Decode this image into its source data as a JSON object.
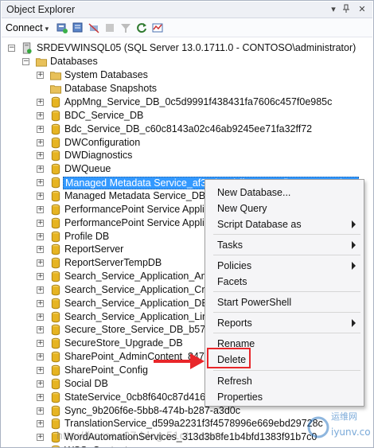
{
  "window": {
    "title": "Object Explorer",
    "pin_icon": "pin-icon",
    "close_icon": "close-icon",
    "dropdown_icon": "dropdown-arrow-icon"
  },
  "toolbar": {
    "connect_label": "Connect",
    "icons": [
      "connect-server-icon",
      "new-query-icon",
      "disconnect-icon",
      "stop-icon",
      "filter-icon",
      "refresh-icon",
      "activity-monitor-icon"
    ]
  },
  "tree": {
    "server": "SRDEVWINSQL05 (SQL Server 13.0.1711.0 - CONTOSO\\administrator)",
    "databases_folder": "Databases",
    "folders": [
      "System Databases",
      "Database Snapshots"
    ],
    "databases": [
      "AppMng_Service_DB_0c5d9991f438431fa7606c457f0e985c",
      "BDC_Service_DB",
      "Bdc_Service_DB_c60c8143a02c46ab9245ee71fa32ff72",
      "DWConfiguration",
      "DWDiagnostics",
      "DWQueue",
      "Managed Metadata Service_af3ad45cbff745a69afbc3ee1040cb9a",
      "Managed Metadata Service_DB",
      "PerformancePoint Service Application_",
      "PerformancePoint Service Application_",
      "Profile DB",
      "ReportServer",
      "ReportServerTempDB",
      "Search_Service_Application_Analytics",
      "Search_Service_Application_Crawl",
      "Search_Service_Application_DB_c",
      "Search_Service_Application_Link",
      "Secure_Store_Service_DB_b5721c",
      "SecureStore_Upgrade_DB",
      "SharePoint_AdminContent_8472",
      "SharePoint_Config",
      "Social DB",
      "StateService_0cb8f640c87d416e",
      "Sync_9b206f6e-5bb8-474b-b287-a3d0c",
      "TranslationService_d599a2231f3f4578996e669ebd29728c",
      "WordAutomationServices_313d3b8fe1b4bfd1383f91b7c0",
      "WSS_Content"
    ],
    "selected_index": 6
  },
  "context_menu": {
    "items": [
      {
        "label": "New Database...",
        "submenu": false
      },
      {
        "label": "New Query",
        "submenu": false
      },
      {
        "label": "Script Database as",
        "submenu": true
      },
      {
        "label": "Tasks",
        "submenu": true
      },
      {
        "label": "Policies",
        "submenu": true
      },
      {
        "label": "Facets",
        "submenu": false
      },
      {
        "label": "Start PowerShell",
        "submenu": false
      },
      {
        "label": "Reports",
        "submenu": true
      },
      {
        "label": "Rename",
        "submenu": false
      },
      {
        "label": "Delete",
        "submenu": false,
        "highlighted": true
      },
      {
        "label": "Refresh",
        "submenu": false
      },
      {
        "label": "Properties",
        "submenu": false
      }
    ]
  },
  "annotation": {
    "arrow_color": "#e8262a",
    "highlight_color": "#e8262a"
  },
  "colors": {
    "selection": "#3399ff",
    "db_icon": "#e6b422",
    "folder_icon": "#e8c15a"
  }
}
